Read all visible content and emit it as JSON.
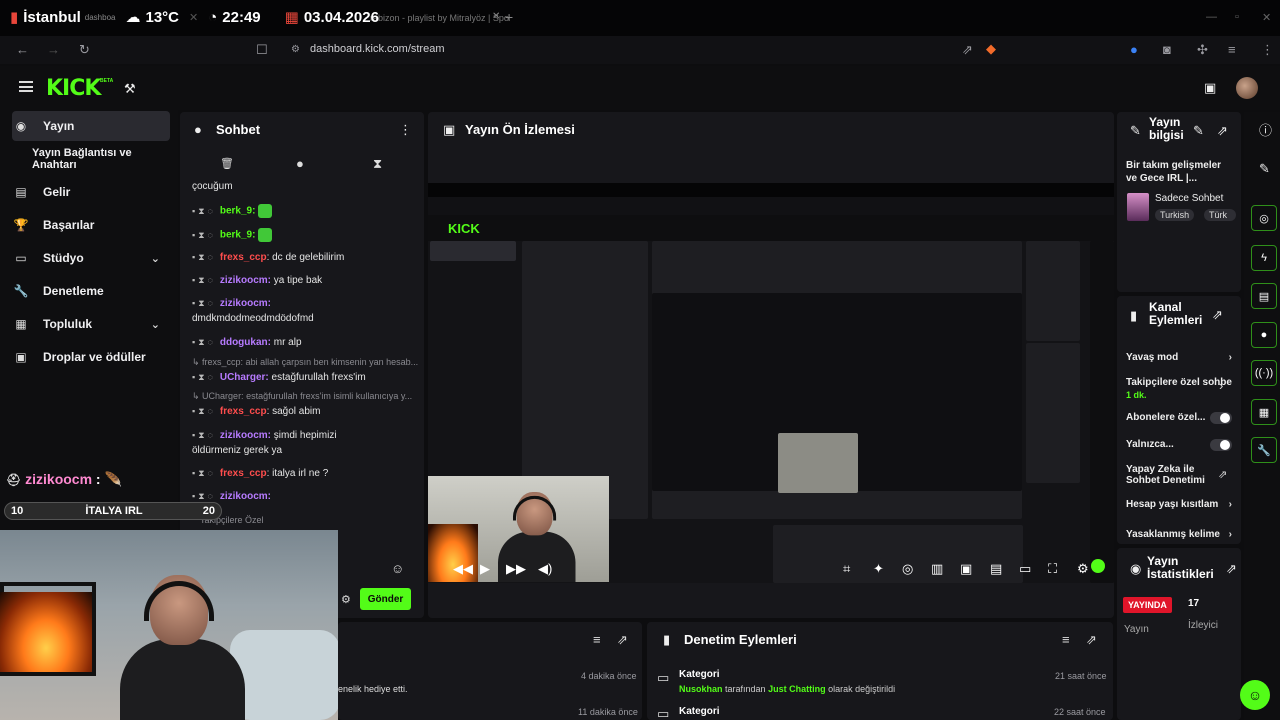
{
  "overlay_top": {
    "city": "İstanbul",
    "temperature": "13°C",
    "time": "22:49",
    "date": "03.04.2026"
  },
  "browser": {
    "tab_title": "rabizon - playlist by Mitralyöz | Spo",
    "tab_prefix": "dashboa",
    "url": "dashboard.kick.com/stream"
  },
  "kick": {
    "logo": "KICK",
    "beta": "BETA"
  },
  "sidebar": {
    "items": [
      {
        "label": "Yayın",
        "icon": "camera-icon"
      },
      {
        "label": "Yayın Bağlantısı ve Anahtarı",
        "icon": ""
      },
      {
        "label": "Gelir",
        "icon": "chart-icon"
      },
      {
        "label": "Başarılar",
        "icon": "trophy-icon"
      },
      {
        "label": "Stüdyo",
        "icon": "monitor-icon"
      },
      {
        "label": "Denetleme",
        "icon": "wrench-icon"
      },
      {
        "label": "Topluluk",
        "icon": "community-icon"
      },
      {
        "label": "Droplar ve ödüller",
        "icon": "gift-icon"
      }
    ]
  },
  "chat": {
    "title": "Sohbet",
    "first_line": "çocuğum",
    "messages": [
      {
        "user": "berk_9:",
        "text": "",
        "color": "green"
      },
      {
        "user": "berk_9:",
        "text": "",
        "color": "green"
      },
      {
        "user": "frexs_ccp",
        "text": ": dc de gelebilirim",
        "color": "red"
      },
      {
        "user": "zizikoocm:",
        "text": " ya tipe bak",
        "color": "purple"
      },
      {
        "user": "zizikoocm:",
        "text": "",
        "color": "purple"
      },
      {
        "user": "",
        "text": "dmdkmdodmeodmdödofmd",
        "color": ""
      },
      {
        "user": "ddogukan:",
        "text": " mr alp",
        "color": "purple"
      },
      {
        "user": "UCharger:",
        "text": " estağfurullah frexs'im",
        "color": "purple"
      },
      {
        "user": "frexs_ccp",
        "text": ": sağol abim",
        "color": "red"
      },
      {
        "user": "zizikoocm:",
        "text": " şimdi hepimizi",
        "color": "purple"
      },
      {
        "user": "",
        "text": "öldürmeniz gerek ya",
        "color": ""
      },
      {
        "user": "frexs_ccp",
        "text": ": italya irl ne ?",
        "color": "red"
      },
      {
        "user": "zizikoocm:",
        "text": "",
        "color": "purple"
      }
    ],
    "replies": [
      "frexs_ccp: abi allah çarpsın ben kimsenin yan hesab...",
      "UCharger: estağfurullah frexs'im isimli kullanıcıya y..."
    ],
    "followers_only": "Takipçilere Özel",
    "send_label": "Gönder"
  },
  "preview": {
    "title": "Yayın Ön İzlemesi"
  },
  "overlay_chat": {
    "user": "zizikoocm",
    "sep": ":"
  },
  "progress": {
    "start": "10",
    "label": "İTALYA IRL",
    "end": "20",
    "fraction": 0.0
  },
  "bottom_left": {
    "rows": [
      {
        "time": "4 dakika önce",
        "text": "enelik hediye etti."
      },
      {
        "time": "11 dakika önce",
        "text": ""
      }
    ]
  },
  "moderation": {
    "title": "Denetim Eylemleri",
    "rows": [
      {
        "category": "Kategori",
        "who": "Nusokhan",
        "mid": " tarafından ",
        "what": "Just Chatting",
        "tail": " olarak değiştirildi",
        "time": "21 saat önce"
      },
      {
        "category": "Kategori",
        "who": "",
        "mid": "",
        "what": "",
        "tail": "",
        "time": "22 saat önce"
      }
    ]
  },
  "stream_info": {
    "title_1": "Yayın",
    "title_2": "bilgisi",
    "stream_title": "Bir takım gelişmeler ve Gece IRL |...",
    "category": "Sadece Sohbet",
    "tags": [
      "Turkish",
      "Türk"
    ]
  },
  "channel_actions": {
    "title_1": "Kanal",
    "title_2": "Eylemleri",
    "items": [
      {
        "label": "Yavaş mod",
        "control": "arrow"
      },
      {
        "label": "Takipçilere özel sohbet",
        "sub": "1 dk.",
        "control": "arrow"
      },
      {
        "label": "Abonelere özel...",
        "control": "toggle"
      },
      {
        "label": "Yalnızca...",
        "control": "toggle"
      },
      {
        "label": "Yapay Zeka ile Sohbet Denetimi",
        "control": "external"
      },
      {
        "label": "Hesap yaşı kısıtlam",
        "control": "arrow"
      },
      {
        "label": "Yasaklanmış kelime",
        "control": "arrow"
      }
    ]
  },
  "stats": {
    "title_1": "Yayın",
    "title_2": "İstatistikleri",
    "live_badge": "YAYINDA",
    "live_label": "Yayın",
    "viewers": "17",
    "viewers_label": "İzleyici"
  },
  "colors": {
    "accent": "#53fc18",
    "panel": "#17171b",
    "live": "#e0152a"
  }
}
